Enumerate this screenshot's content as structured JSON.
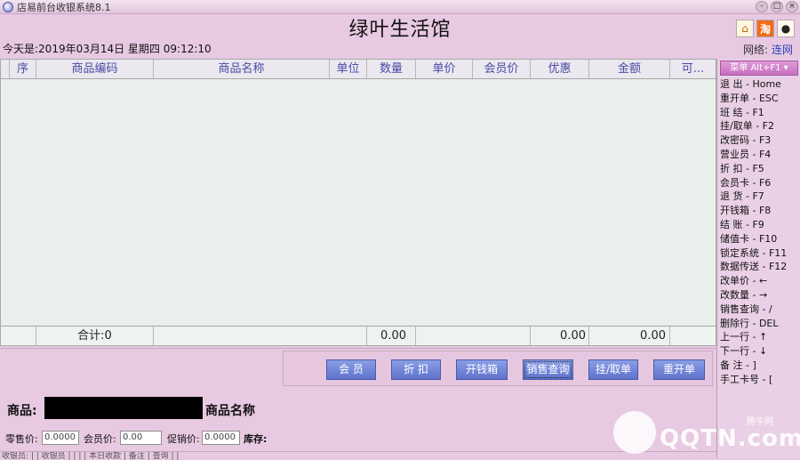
{
  "window": {
    "title": "店易前台收银系统8.1",
    "controls": [
      "-",
      "□",
      "×"
    ]
  },
  "header": {
    "store_name": "绿叶生活馆",
    "datetime": "今天是:2019年03月14日  星期四  09:12:10",
    "network_label": "网络:",
    "network_value": "连网",
    "icons": [
      "home-icon",
      "taobao-icon",
      "qq-icon"
    ]
  },
  "grid": {
    "columns": [
      "序",
      "商品编码",
      "商品名称",
      "单位",
      "数量",
      "单价",
      "会员价",
      "优惠",
      "金额",
      "可..."
    ],
    "total": {
      "label": "合计:0",
      "quantity": "0.00",
      "discount": "0.00",
      "amount": "0.00"
    }
  },
  "shortcuts": {
    "menu_button": "菜单 Alt+F1 ▾",
    "items": [
      "退  出 - Home",
      "重开单 - ESC",
      "班  结 - F1",
      "挂/取单 - F2",
      "改密码 - F3",
      "营业员 - F4",
      "折  扣 - F5",
      "会员卡 - F6",
      "退  货 - F7",
      "开钱箱 - F8",
      "结  账 - F9",
      "储值卡 - F10",
      "锁定系统 - F11",
      "数据传送 - F12",
      "改单价 - ←",
      "改数量 - →",
      "销售查询 - /",
      "删除行 - DEL",
      "上一行 - ↑",
      "下一行 - ↓",
      "备  注 - ]",
      "手工卡号 - ["
    ]
  },
  "actions": [
    "会  员",
    "折  扣",
    "开钱箱",
    "销售查询",
    "挂/取单",
    "重开单"
  ],
  "goods": {
    "label": "商品:",
    "name": "商品名称",
    "retail_label": "零售价:",
    "retail_value": "0.0000",
    "member_label": "会员价:",
    "member_value": "0.00",
    "promo_label": "促销价:",
    "promo_value": "0.0000",
    "stock_label": "库存:"
  },
  "statusbar": "收银员:  |  |  收银员  |  |  |  |  本日收款  |  备注  |  查询  |  |",
  "watermark": {
    "brand": "QQTN.com",
    "cn": "腾牛网"
  },
  "colors": {
    "background": "#e8c9e2",
    "grid": "#e9f0eb",
    "button": "#6f82d6",
    "header_text": "#4a4aa8"
  }
}
